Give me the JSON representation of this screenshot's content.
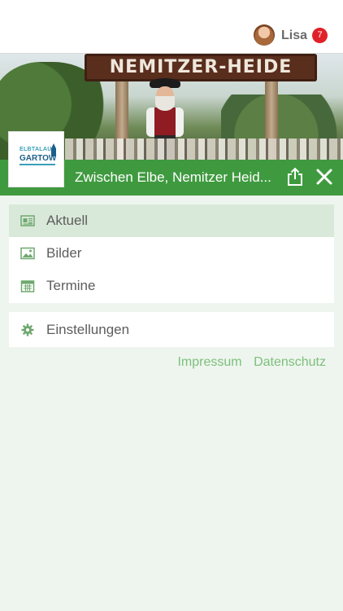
{
  "header": {
    "username": "Lisa",
    "notification_count": "7"
  },
  "hero": {
    "sign_text": "NEMITZER-HEIDE",
    "logo_line1": "ELBTALAUE",
    "logo_line2": "GARTOW"
  },
  "titlebar": {
    "title": "Zwischen Elbe, Nemitzer Heid..."
  },
  "menu": {
    "items": [
      {
        "label": "Aktuell",
        "icon": "newspaper-icon"
      },
      {
        "label": "Bilder",
        "icon": "image-icon"
      },
      {
        "label": "Termine",
        "icon": "calendar-icon"
      }
    ],
    "settings": {
      "label": "Einstellungen",
      "icon": "gear-icon"
    }
  },
  "footer_links": {
    "impressum": "Impressum",
    "datenschutz": "Datenschutz"
  },
  "colors": {
    "accent_green": "#3f9a3f",
    "active_row": "#d9e9d9",
    "link_green": "#7dbf7d",
    "badge_red": "#e02127",
    "background": "#eef5ee"
  }
}
